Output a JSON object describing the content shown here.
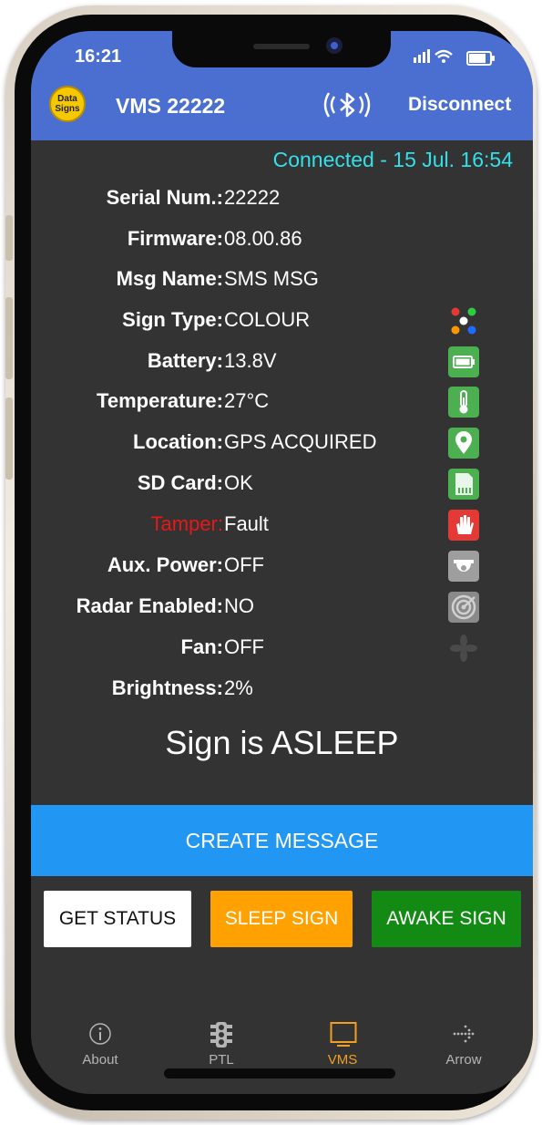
{
  "status_bar": {
    "time": "16:21"
  },
  "app_bar": {
    "logo_line1": "Data",
    "logo_line2": "Signs",
    "title": "VMS 22222",
    "disconnect_label": "Disconnect"
  },
  "connection_status": "Connected - 15 Jul. 16:54",
  "info": [
    {
      "label": "Serial Num.:",
      "value": "22222",
      "icon": ""
    },
    {
      "label": "Firmware:",
      "value": "08.00.86",
      "icon": ""
    },
    {
      "label": "Msg Name:",
      "value": "SMS MSG",
      "icon": ""
    },
    {
      "label": "Sign Type:",
      "value": "COLOUR",
      "icon": "colour-dots-icon"
    },
    {
      "label": "Battery:",
      "value": "13.8V",
      "icon": "battery-icon"
    },
    {
      "label": "Temperature:",
      "value": "27°C",
      "icon": "thermometer-icon"
    },
    {
      "label": "Location:",
      "value": "GPS ACQUIRED",
      "icon": "location-pin-icon"
    },
    {
      "label": "SD Card:",
      "value": "OK",
      "icon": "sd-card-icon"
    },
    {
      "label": "Tamper:",
      "value": "Fault",
      "icon": "tamper-hand-icon"
    },
    {
      "label": "Aux. Power:",
      "value": "OFF",
      "icon": "camera-dome-icon"
    },
    {
      "label": "Radar Enabled:",
      "value": "NO",
      "icon": "radar-icon"
    },
    {
      "label": "Fan:",
      "value": "OFF",
      "icon": "fan-icon"
    },
    {
      "label": "Brightness:",
      "value": "2%",
      "icon": ""
    }
  ],
  "sign_status": "Sign is ASLEEP",
  "buttons": {
    "create_message": "CREATE MESSAGE",
    "get_status": "GET STATUS",
    "sleep_sign": "SLEEP SIGN",
    "awake_sign": "AWAKE SIGN"
  },
  "tabs": [
    {
      "label": "About",
      "icon": "info-icon"
    },
    {
      "label": "PTL",
      "icon": "traffic-light-icon"
    },
    {
      "label": "VMS",
      "icon": "monitor-icon",
      "active": true
    },
    {
      "label": "Arrow",
      "icon": "arrow-dots-icon"
    }
  ],
  "colors": {
    "app_bar": "#4a6fd0",
    "background": "#333333",
    "connected_text": "#33e0ea",
    "tamper_label": "#e81818",
    "create_button": "#2196f3",
    "sleep_button": "#ffa100",
    "awake_button": "#128a14",
    "active_tab": "#f0a020"
  }
}
